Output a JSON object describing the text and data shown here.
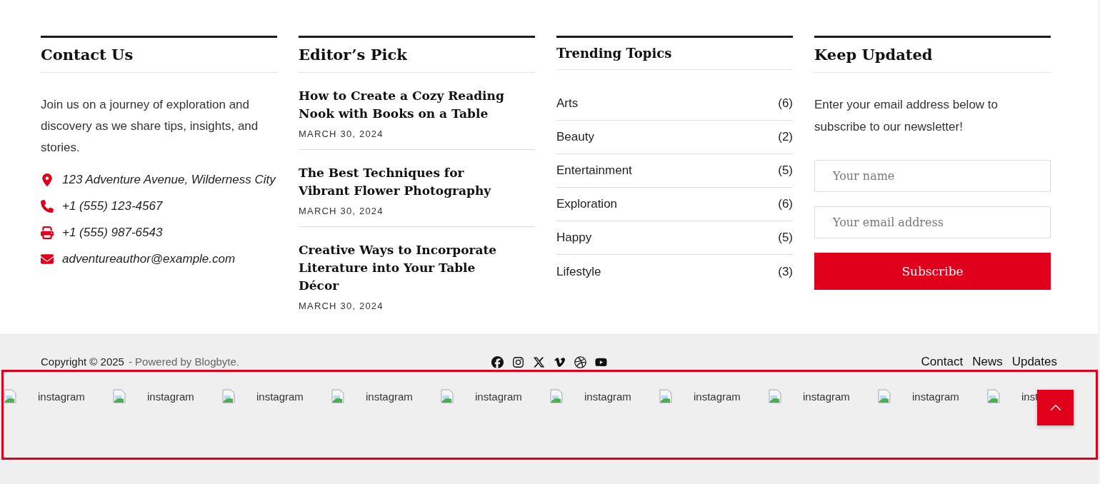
{
  "contact": {
    "title": "Contact Us",
    "intro": "Join us on a journey of exploration and discovery as we share tips, insights, and stories.",
    "items": [
      {
        "kind": "location",
        "text": "123 Adventure Avenue, Wilderness City"
      },
      {
        "kind": "phone",
        "text": "+1 (555) 123-4567"
      },
      {
        "kind": "fax",
        "text": "+1 (555) 987-6543"
      },
      {
        "kind": "email",
        "text": "adventureauthor@example.com"
      }
    ]
  },
  "editors_pick": {
    "title": "Editor’s Pick",
    "posts": [
      {
        "title": "How to Create a Cozy Reading Nook with Books on a Table",
        "date": "MARCH 30, 2024"
      },
      {
        "title": "The Best Techniques for Vibrant Flower Photography",
        "date": "MARCH 30, 2024"
      },
      {
        "title": "Creative Ways to Incorporate Literature into Your Table Décor",
        "date": "MARCH 30, 2024"
      }
    ]
  },
  "trending": {
    "title": "Trending Topics",
    "topics": [
      {
        "name": "Arts",
        "count": "(6)"
      },
      {
        "name": "Beauty",
        "count": "(2)"
      },
      {
        "name": "Entertainment",
        "count": "(5)"
      },
      {
        "name": "Exploration",
        "count": "(6)"
      },
      {
        "name": "Happy",
        "count": "(5)"
      },
      {
        "name": "Lifestyle",
        "count": "(3)"
      }
    ]
  },
  "newsletter": {
    "title": "Keep Updated",
    "intro": "Enter your email address below to subscribe to our newsletter!",
    "name_placeholder": "Your name",
    "email_placeholder": "Your email address",
    "button": "Subscribe"
  },
  "footer": {
    "copyright": "Copyright © 2025",
    "powered": "- Powered by Blogbyte.",
    "social": [
      {
        "kind": "facebook"
      },
      {
        "kind": "instagram"
      },
      {
        "kind": "x"
      },
      {
        "kind": "vimeo"
      },
      {
        "kind": "dribbble"
      },
      {
        "kind": "youtube"
      }
    ],
    "links": [
      "Contact",
      "News",
      "Updates"
    ]
  },
  "instagram_feed": [
    "instagram",
    "instagram",
    "instagram",
    "instagram",
    "instagram",
    "instagram",
    "instagram",
    "instagram",
    "instagram",
    "inst"
  ]
}
